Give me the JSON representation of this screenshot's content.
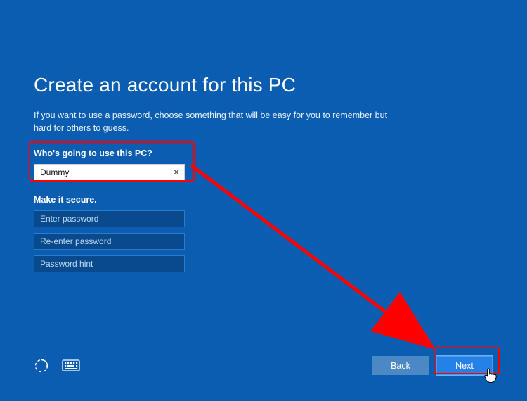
{
  "title": "Create an account for this PC",
  "subtitle": "If you want to use a password, choose something that will be easy for you to remember but hard for others to guess.",
  "user_section_label": "Who's going to use this PC?",
  "username_value": "Dummy",
  "secure_section_label": "Make it secure.",
  "password_placeholder": "Enter password",
  "confirm_placeholder": "Re-enter password",
  "hint_placeholder": "Password hint",
  "back_label": "Back",
  "next_label": "Next",
  "clear_glyph": "✕"
}
